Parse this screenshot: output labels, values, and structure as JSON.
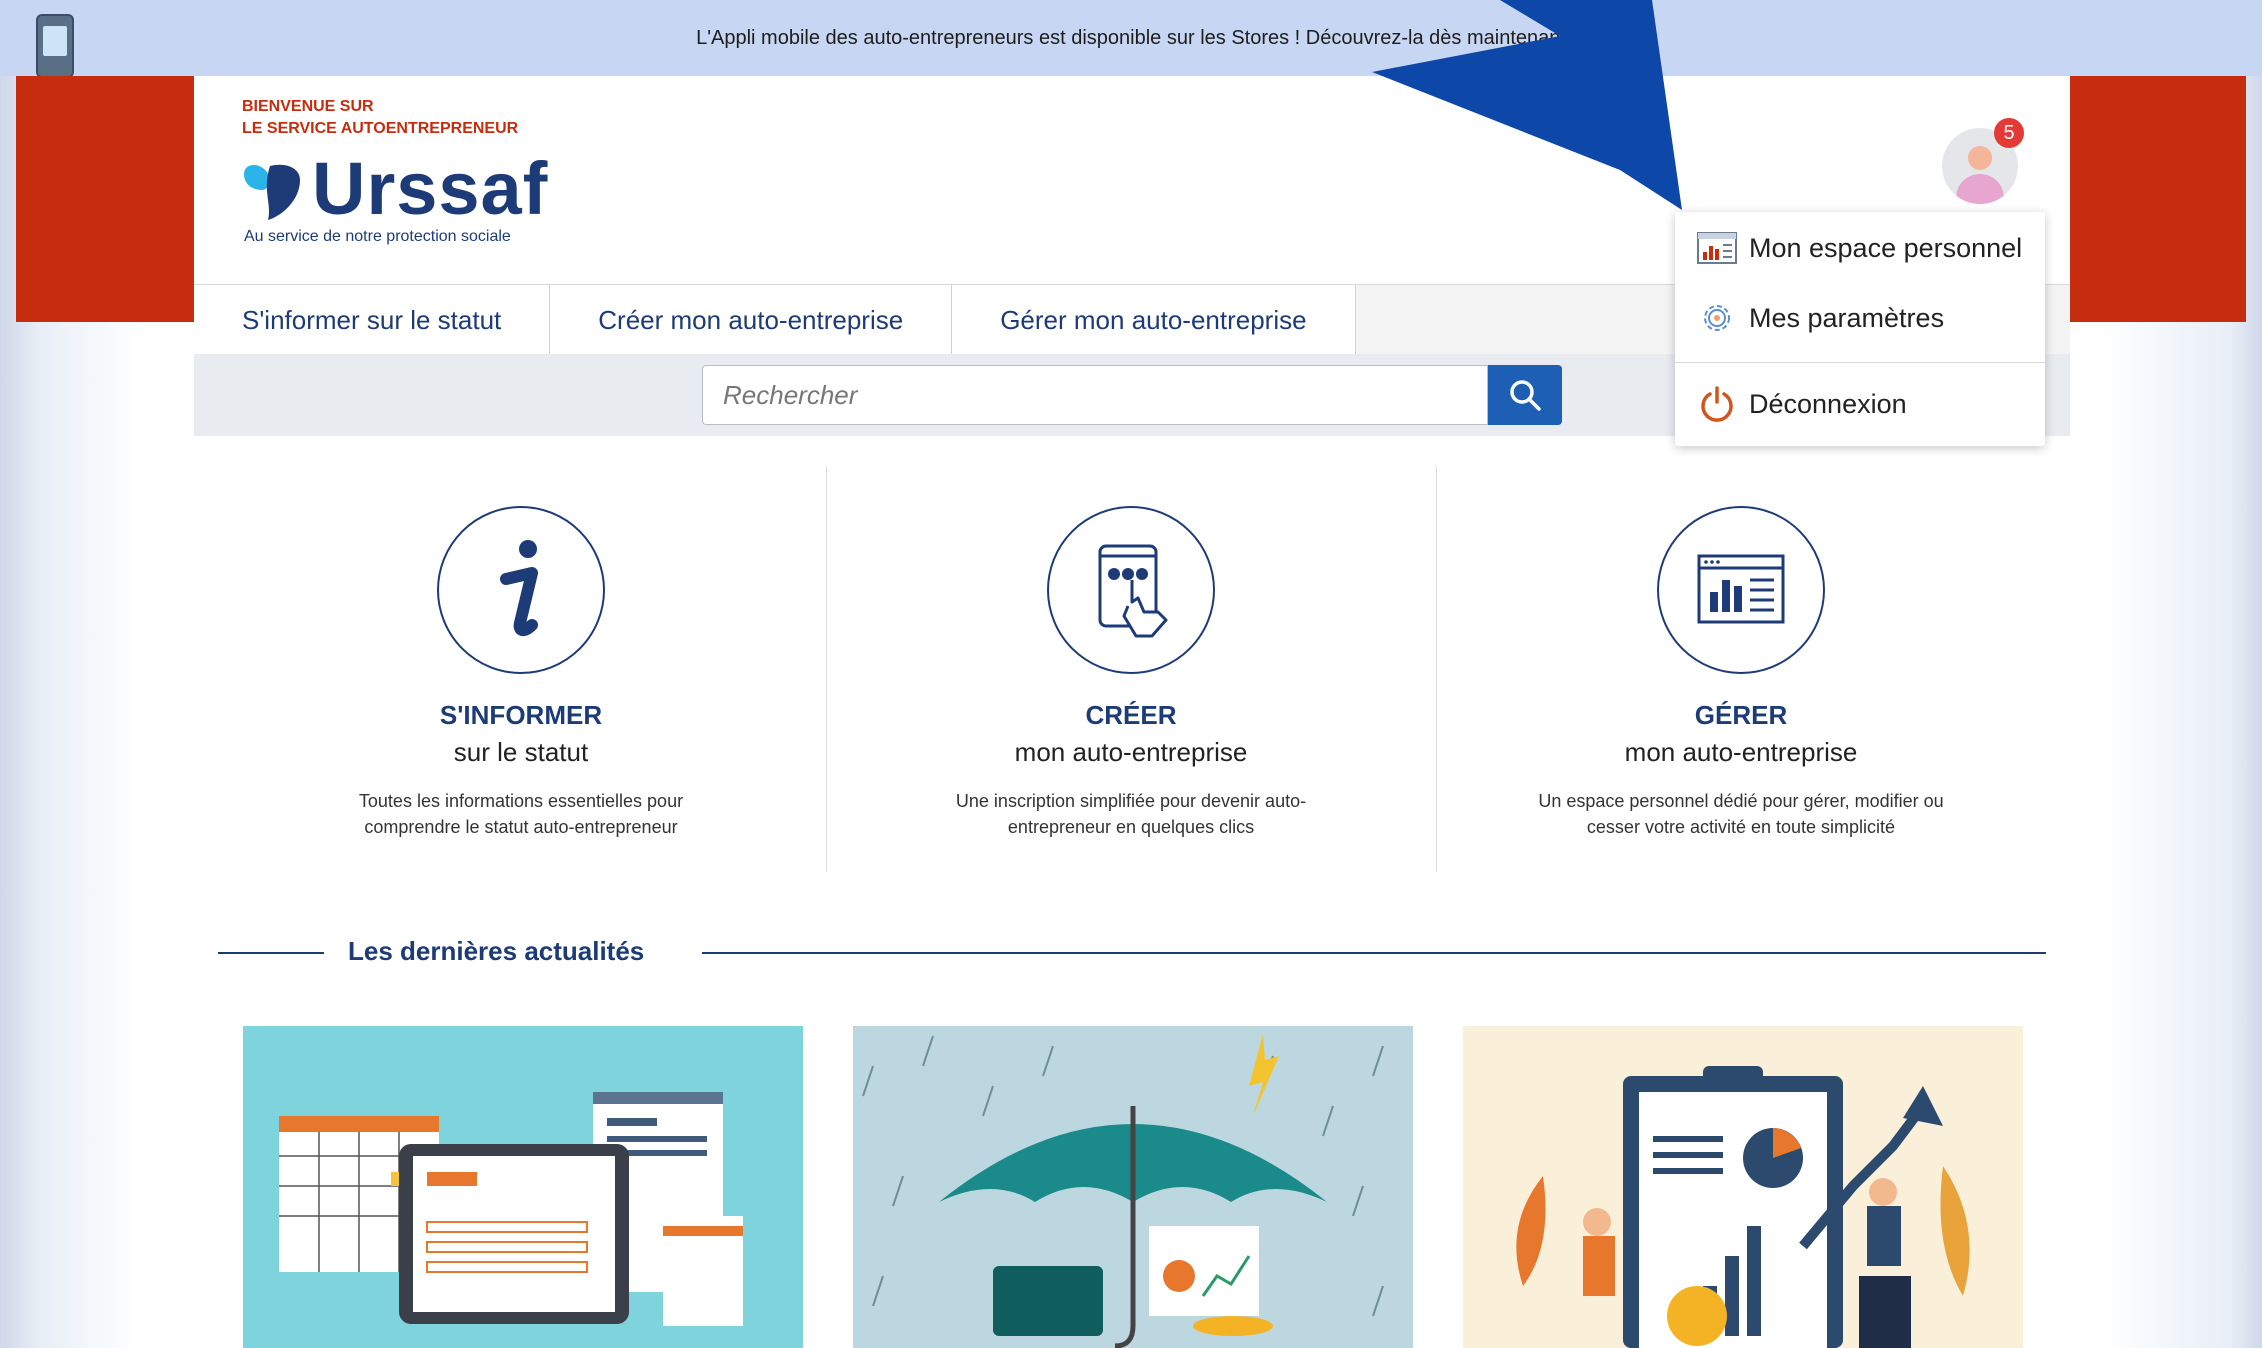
{
  "banner": {
    "text": "L'Appli mobile des auto-entrepreneurs est disponible sur les Stores ! Découvrez-la dès maintenant"
  },
  "header": {
    "welcome_line1": "BIENVENUE SUR",
    "welcome_line2": "LE SERVICE AUTOENTREPRENEUR",
    "logo_text": "Urssaf",
    "logo_tagline": "Au service de notre protection sociale"
  },
  "nav": {
    "items": [
      {
        "label": "S'informer sur le statut"
      },
      {
        "label": "Créer mon auto-entreprise"
      },
      {
        "label": "Gérer mon auto-entreprise"
      }
    ]
  },
  "search": {
    "placeholder": "Rechercher"
  },
  "user": {
    "notification_count": "5"
  },
  "dropdown": {
    "items": [
      {
        "label": "Mon espace personnel",
        "icon": "dashboard-icon"
      },
      {
        "label": "Mes paramètres",
        "icon": "gear-icon"
      },
      {
        "label": "Déconnexion",
        "icon": "power-icon"
      }
    ]
  },
  "features": [
    {
      "title": "S'INFORMER",
      "subtitle": "sur le statut",
      "desc1": "Toutes les informations essentielles pour",
      "desc2": "comprendre le statut auto-entrepreneur",
      "icon": "info-icon"
    },
    {
      "title": "CRÉER",
      "subtitle": "mon auto-entreprise",
      "desc1": "Une inscription simplifiée pour devenir auto-",
      "desc2": "entrepreneur en quelques clics",
      "icon": "tablet-touch-icon"
    },
    {
      "title": "GÉRER",
      "subtitle": "mon auto-entreprise",
      "desc1": "Un espace personnel dédié pour gérer, modifier ou",
      "desc2": "cesser votre activité en toute simplicité",
      "icon": "dashboard-icon"
    }
  ],
  "news": {
    "title": "Les dernières actualités"
  },
  "colors": {
    "brand_red": "#c62d0e",
    "brand_blue": "#1d3b77",
    "search_blue": "#1d5fb5",
    "annotation_arrow": "#0d47a8"
  }
}
